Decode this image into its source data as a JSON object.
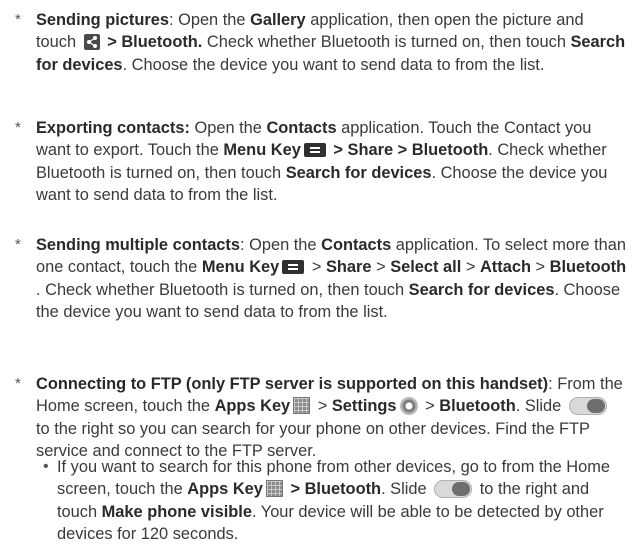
{
  "items": [
    {
      "lead": "Sending pictures",
      "t1": ": Open the ",
      "k1": "Gallery",
      "t2": " application, then open the picture and touch ",
      "k2": " > Bluetooth.",
      "t3": " Check whether Bluetooth is turned on, then touch ",
      "k3": "Search for devices",
      "t4": ". Choose the device you want to send data to from the list."
    },
    {
      "lead": "Exporting contacts:",
      "t1": " Open the ",
      "k1": "Contacts",
      "t2": " application. Touch the Contact you want to export. Touch the ",
      "k2": "Menu Key",
      "k3": " > Share > Bluetooth",
      "t3": ". Check whether Bluetooth is turned on, then touch ",
      "k4": "Search for devices",
      "t4": ". Choose the device you want to send data to from the list."
    },
    {
      "lead": "Sending multiple contacts",
      "t1": ": Open the ",
      "k1": "Contacts",
      "t2": " application. To select more than one contact, touch the ",
      "k2": "Menu Key",
      "t3": " > ",
      "k3": "Share",
      "t4": " > ",
      "k4": "Select all",
      "t5": " > ",
      "k5": "Attach",
      "t6": " > ",
      "k6": "Bluetooth",
      "t7": " . Check whether Bluetooth is turned on, then touch ",
      "k7": "Search for devices",
      "t8": ". Choose the device you want to send data to from the list."
    },
    {
      "lead": "Connecting to FTP (only FTP server is supported on this handset)",
      "t1": ": From the Home screen, touch the ",
      "k1": "Apps Key",
      "t2": " > ",
      "k2": "Settings",
      "t3": " > ",
      "k3": "Bluetooth",
      "t4": ". Slide ",
      "t5": " to the right so you can search for your phone on other devices. Find the FTP service and connect to the FTP server."
    }
  ],
  "sub_item": {
    "t1": "If you want to search for this phone from other devices, go to from the Home screen, touch the ",
    "k1": "Apps Key",
    "k2": " > Bluetooth",
    "t2": ". Slide ",
    "t3": " to the right and touch ",
    "k3": "Make phone visible",
    "t4": ". Your device will be able to be detected by other devices for 120 seconds."
  },
  "markers": {
    "star": "*",
    "bullet": "•"
  },
  "icons": {
    "share": "share-icon",
    "menu": "menu-key-icon",
    "apps": "apps-key-icon",
    "settings": "settings-gear-icon",
    "toggle": "bluetooth-toggle-icon"
  }
}
